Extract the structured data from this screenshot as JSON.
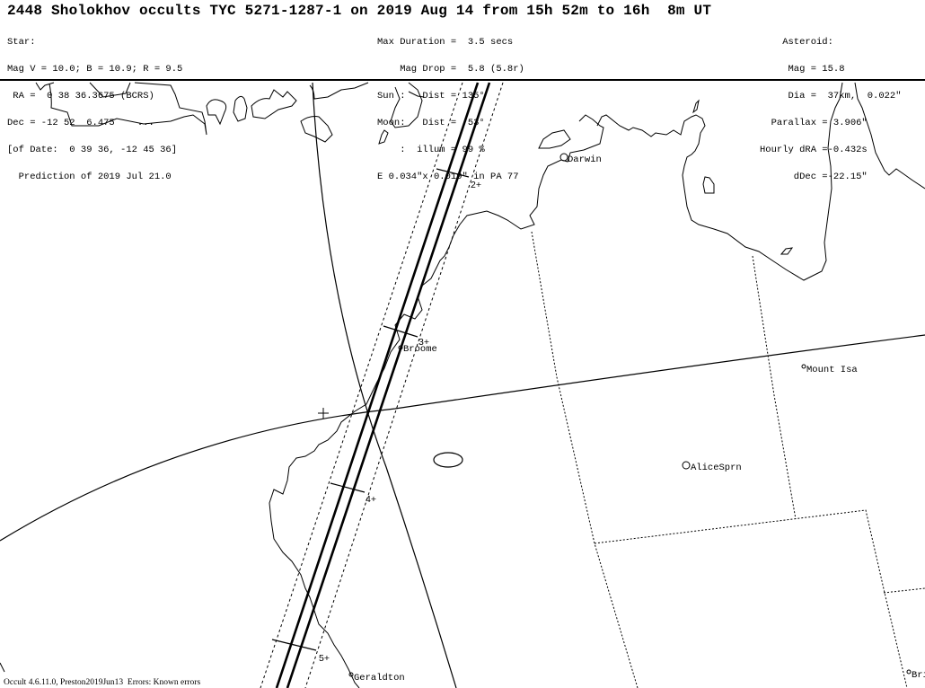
{
  "header": {
    "title": "2448 Sholokhov occults TYC 5271-1287-1 on 2019 Aug 14 from 15h 52m to 16h  8m UT",
    "star": [
      "Star:",
      "Mag V = 10.0; B = 10.9; R = 9.5",
      " RA =  0 38 36.3675 (BCRS)",
      "Dec = -12 52  6.475    ...",
      "[of Date:  0 39 36, -12 45 36]",
      "  Prediction of 2019 Jul 21.0"
    ],
    "event": [
      "Max Duration =  3.5 secs",
      "    Mag Drop =  5.8 (5.8r)",
      "Sun :   Dist = 135°",
      "Moon:   Dist =  53°",
      "    :  illum = 99 %",
      "E 0.034\"x 0.019\" in PA 77"
    ],
    "asteroid": [
      "    Asteroid:",
      "     Mag = 15.8",
      "     Dia =  37km,  0.022\"",
      "  Parallax = 3.906\"",
      "Hourly dRA =-0.432s",
      "      dDec =-22.15\""
    ]
  },
  "map": {
    "cities": [
      {
        "name": "Darwin",
        "size": "large"
      },
      {
        "name": "Broome",
        "size": "small"
      },
      {
        "name": "Mount Isa",
        "size": "small"
      },
      {
        "name": "AliceSprn",
        "size": "large"
      },
      {
        "name": "Geraldton",
        "size": "small"
      },
      {
        "name": "Bri",
        "size": "small"
      }
    ],
    "time_marks": [
      "2+",
      "3+",
      "4+",
      "5+"
    ],
    "center_marker": "+"
  },
  "footer": {
    "text": "Occult 4.6.11.0, Preston2019Jun13  Errors: Known errors"
  },
  "colors": {
    "lines": "#000000",
    "background": "#ffffff"
  }
}
